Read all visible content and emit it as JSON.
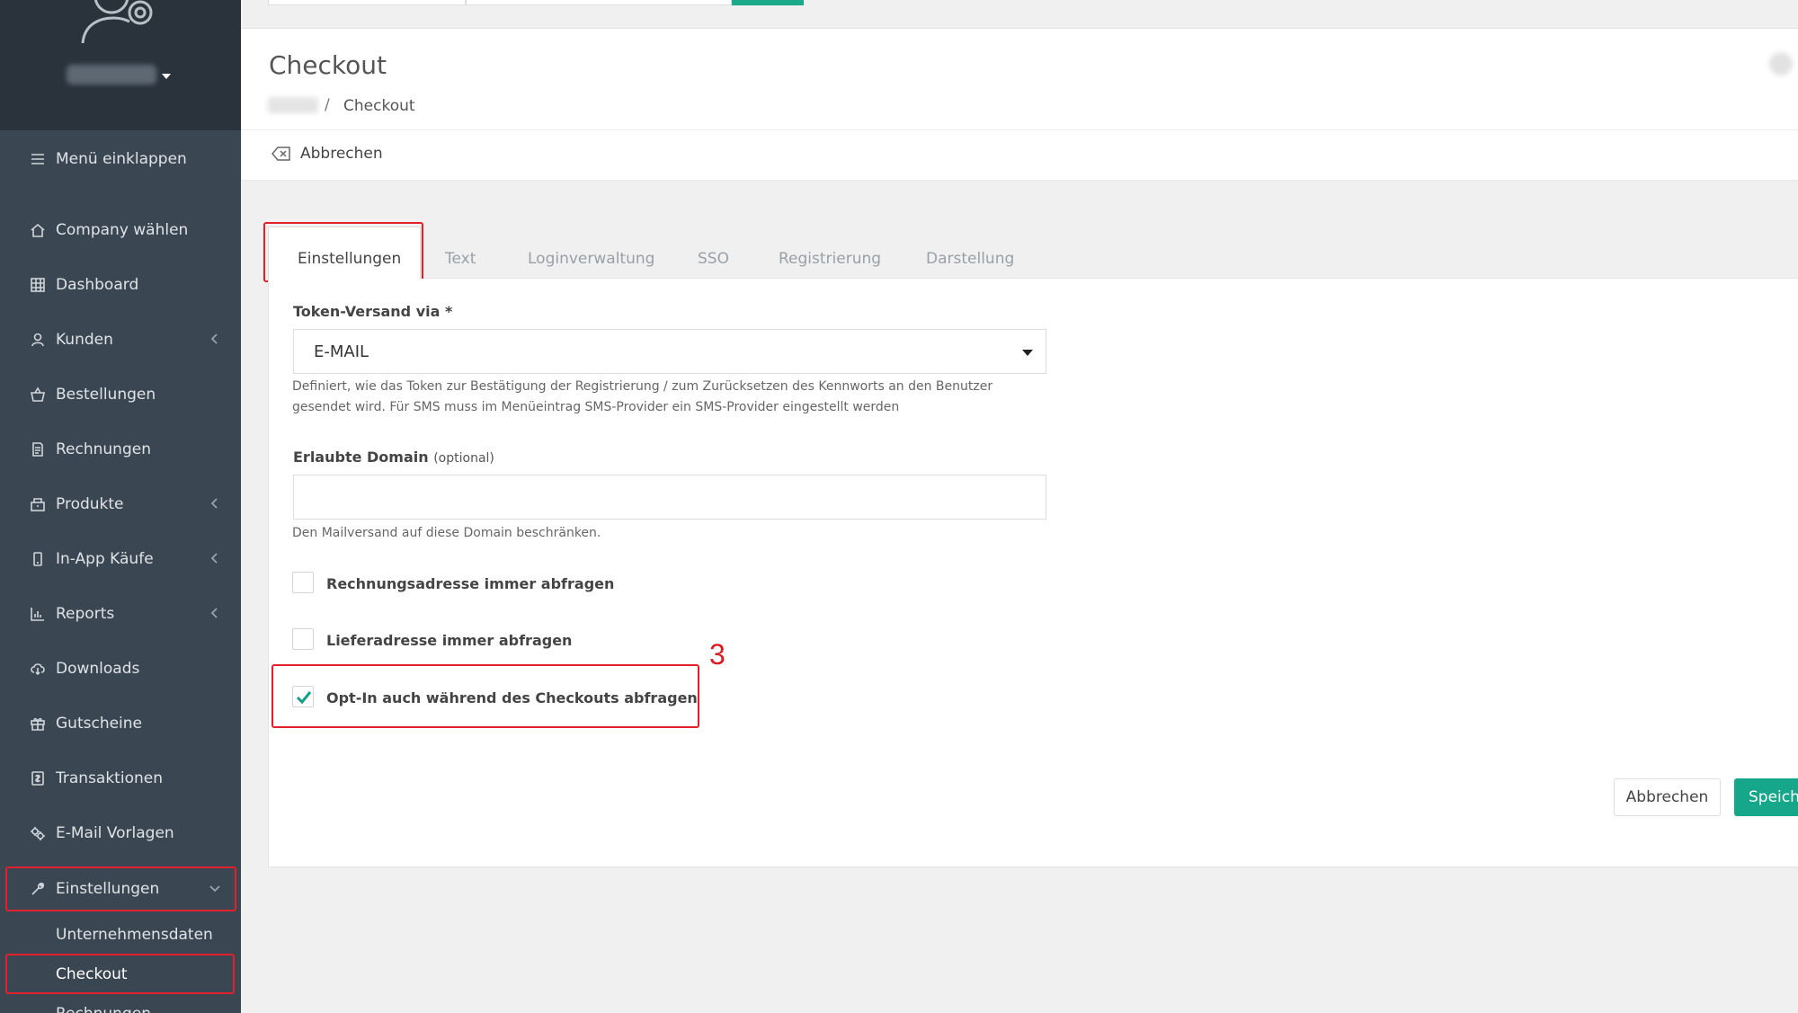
{
  "sidebar": {
    "collapse_label": "Menü einklappen",
    "items": [
      {
        "label": "Company wählen",
        "icon": "home-icon"
      },
      {
        "label": "Dashboard",
        "icon": "grid-icon"
      },
      {
        "label": "Kunden",
        "icon": "user-icon"
      },
      {
        "label": "Bestellungen",
        "icon": "basket-icon"
      },
      {
        "label": "Rechnungen",
        "icon": "invoice-icon"
      },
      {
        "label": "Produkte",
        "icon": "box-icon"
      },
      {
        "label": "In-App Käufe",
        "icon": "phone-icon"
      },
      {
        "label": "Reports",
        "icon": "chart-icon"
      },
      {
        "label": "Downloads",
        "icon": "cloud-download-icon"
      },
      {
        "label": "Gutscheine",
        "icon": "gift-icon"
      },
      {
        "label": "Transaktionen",
        "icon": "transaction-icon"
      },
      {
        "label": "E-Mail Vorlagen",
        "icon": "gears-icon"
      },
      {
        "label": "Einstellungen",
        "icon": "wrench-icon"
      }
    ],
    "subitems": [
      {
        "label": "Unternehmensdaten"
      },
      {
        "label": "Checkout"
      },
      {
        "label": "Rechnungen"
      }
    ]
  },
  "header": {
    "title": "Checkout",
    "breadcrumb_separator": "/",
    "breadcrumb_current": "Checkout"
  },
  "actions": {
    "cancel_label": "Abbrechen"
  },
  "tabs": [
    {
      "label": "Einstellungen"
    },
    {
      "label": "Text"
    },
    {
      "label": "Loginverwaltung"
    },
    {
      "label": "SSO"
    },
    {
      "label": "Registrierung"
    },
    {
      "label": "Darstellung"
    }
  ],
  "form": {
    "token_label": "Token-Versand via *",
    "token_value": "E-MAIL",
    "token_help_line1": "Definiert, wie das Token zur Bestätigung der Registrierung / zum Zurücksetzen des Kennworts an den Benutzer",
    "token_help_line2": "gesendet wird. Für SMS muss im Menüeintrag SMS-Provider ein SMS-Provider eingestellt werden",
    "domain_label": "Erlaubte Domain",
    "domain_optional": "(optional)",
    "domain_value": "",
    "domain_help": "Den Mailversand auf diese Domain beschränken.",
    "checkboxes": [
      {
        "label": "Rechnungsadresse immer abfragen",
        "checked": false
      },
      {
        "label": "Lieferadresse immer abfragen",
        "checked": false
      },
      {
        "label": "Opt-In auch während des Checkouts abfragen",
        "checked": true
      }
    ]
  },
  "annotation": {
    "step_number": "3"
  },
  "footer": {
    "cancel_label": "Abbrechen",
    "save_label": "Speichern"
  },
  "colors": {
    "sidebar": "#3a4651",
    "sidebar_top": "#2a333c",
    "accent": "#16a689",
    "highlight": "#e0202a"
  }
}
